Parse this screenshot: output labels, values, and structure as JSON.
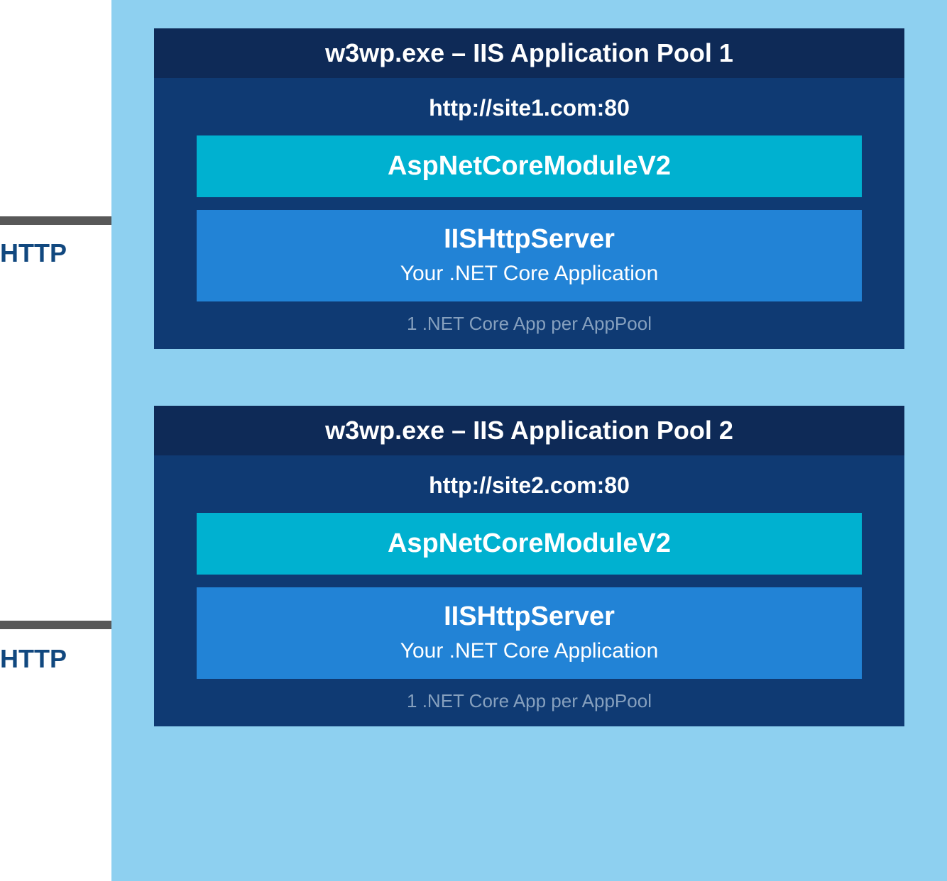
{
  "http_label": "HTTP",
  "pools": [
    {
      "header": "w3wp.exe – IIS Application Pool 1",
      "site_url": "http://site1.com:80",
      "module": "AspNetCoreModuleV2",
      "server_title": "IISHttpServer",
      "server_subtitle": "Your .NET Core Application",
      "footer": "1 .NET Core App per AppPool"
    },
    {
      "header": "w3wp.exe – IIS Application Pool 2",
      "site_url": "http://site2.com:80",
      "module": "AspNetCoreModuleV2",
      "server_title": "IISHttpServer",
      "server_subtitle": "Your .NET Core Application",
      "footer": "1 .NET Core App per AppPool"
    }
  ]
}
